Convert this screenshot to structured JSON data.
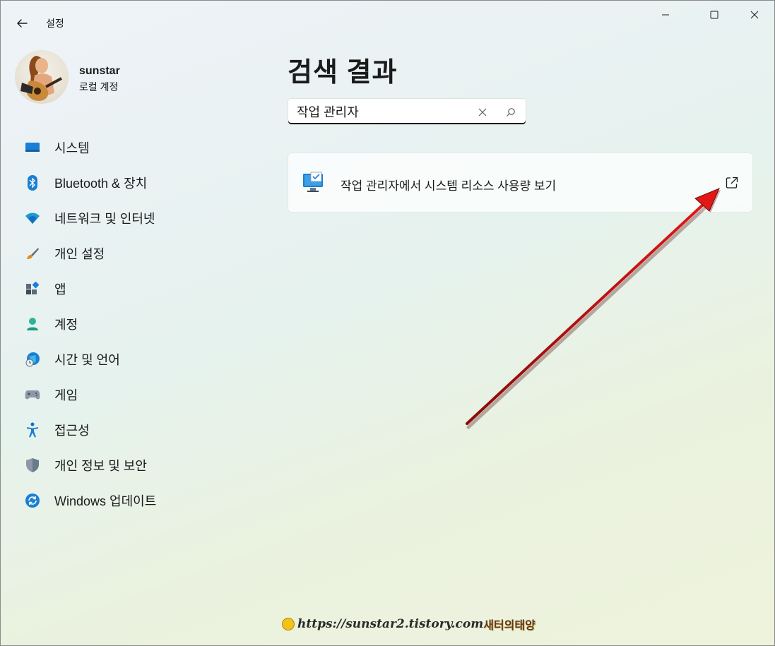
{
  "window": {
    "title": "설정",
    "controls": [
      "minimize",
      "maximize",
      "close"
    ]
  },
  "profile": {
    "name": "sunstar",
    "account_type": "로컬 계정"
  },
  "sidebar": {
    "items": [
      {
        "label": "시스템",
        "icon": "system-icon"
      },
      {
        "label": "Bluetooth & 장치",
        "icon": "bluetooth-icon"
      },
      {
        "label": "네트워크 및 인터넷",
        "icon": "network-icon"
      },
      {
        "label": "개인 설정",
        "icon": "brush-icon"
      },
      {
        "label": "앱",
        "icon": "apps-icon"
      },
      {
        "label": "계정",
        "icon": "account-icon"
      },
      {
        "label": "시간 및 언어",
        "icon": "time-language-icon"
      },
      {
        "label": "게임",
        "icon": "gamepad-icon"
      },
      {
        "label": "접근성",
        "icon": "accessibility-icon"
      },
      {
        "label": "개인 정보 및 보안",
        "icon": "shield-icon"
      },
      {
        "label": "Windows 업데이트",
        "icon": "update-icon"
      }
    ]
  },
  "main": {
    "title": "검색 결과",
    "search": {
      "value": "작업 관리자"
    },
    "results": [
      {
        "label": "작업 관리자에서 시스템 리소스 사용량 보기",
        "icon": "task-manager-icon",
        "action_icon": "open-external-icon"
      }
    ]
  },
  "watermark": {
    "url": "https://sunstar2.tistory.com",
    "brand": "새터의태양"
  },
  "colors": {
    "accent": "#0067c0",
    "arrow": "#cc1111"
  }
}
